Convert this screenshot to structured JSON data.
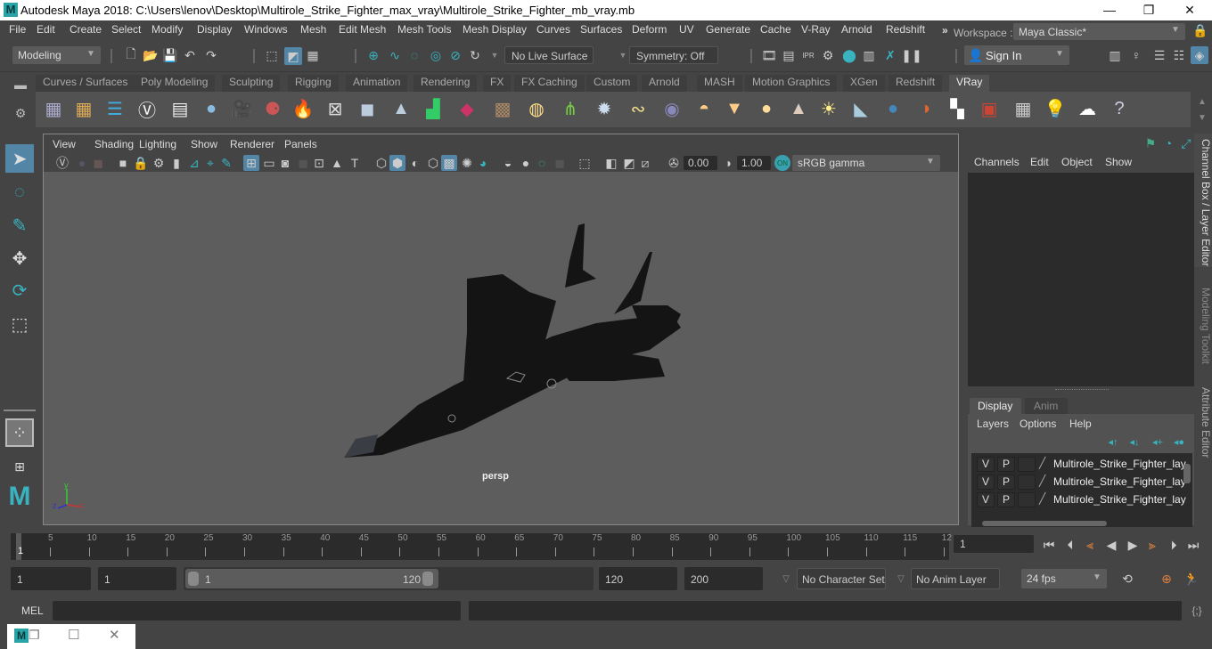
{
  "window": {
    "app_icon": "M",
    "title": "Autodesk Maya 2018: C:\\Users\\lenov\\Desktop\\Multirole_Strike_Fighter_max_vray\\Multirole_Strike_Fighter_mb_vray.mb",
    "minimize": "—",
    "maximize": "❐",
    "close": "✕"
  },
  "menubar": {
    "items": [
      "File",
      "Edit",
      "Create",
      "Select",
      "Modify",
      "Display",
      "Windows",
      "Mesh",
      "Edit Mesh",
      "Mesh Tools",
      "Mesh Display",
      "Curves",
      "Surfaces",
      "Deform",
      "UV",
      "Generate",
      "Cache",
      "V-Ray",
      "Arnold",
      "Redshift"
    ],
    "overflow": "»",
    "workspace_label": "Workspace :",
    "workspace_value": "Maya Classic*"
  },
  "statusline": {
    "menuset": "Modeling",
    "live_surface": "No Live Surface",
    "symmetry": "Symmetry: Off",
    "sign_in": "Sign In"
  },
  "shelf": {
    "tabs": [
      "Curves / Surfaces",
      "Poly Modeling",
      "Sculpting",
      "Rigging",
      "Animation",
      "Rendering",
      "FX",
      "FX Caching",
      "Custom",
      "Arnold",
      "MASH",
      "Motion Graphics",
      "XGen",
      "Redshift",
      "VRay"
    ],
    "active_tab": "VRay",
    "icons": [
      "vray-save-icon",
      "vray-load-icon",
      "vray-settings-list-icon",
      "vray-logo-icon",
      "vray-frame-buffer-icon",
      "vray-material-icon",
      "vray-camera-icon",
      "vray-multi-material-icon",
      "vray-fire-icon",
      "vray-proxy-icon",
      "vray-box-icon",
      "vray-primitive-icon",
      "vray-light-icon",
      "vray-mesh-icon",
      "vray-texture-icon",
      "vray-sphere-icon",
      "vray-fur-icon",
      "vray-displacement-icon",
      "vray-curve-icon",
      "vray-dome-icon",
      "vray-rect-light-icon",
      "vray-mesh-light-icon",
      "vray-sphere-light-icon",
      "vray-ies-light-icon",
      "vray-sun-icon",
      "vray-plane-icon",
      "vray-blue-sphere-icon",
      "vray-color-sphere-icon",
      "vray-checker-icon",
      "vray-render-icon",
      "vray-options-icon",
      "vray-light-lister-icon",
      "vray-cloud-icon",
      "help-icon"
    ]
  },
  "viewport": {
    "menus": [
      "View",
      "Shading",
      "Lighting",
      "Show",
      "Renderer",
      "Panels"
    ],
    "exposure": "0.00",
    "gamma": "1.00",
    "color_space": "sRGB gamma",
    "camera_label": "persp",
    "axis": {
      "x": "x",
      "y": "y",
      "z": "z"
    }
  },
  "channelbox": {
    "menus": [
      "Channels",
      "Edit",
      "Object",
      "Show"
    ],
    "layer_tabs": [
      "Display",
      "Anim"
    ],
    "active_layer_tab": "Display",
    "layer_menus": [
      "Layers",
      "Options",
      "Help"
    ],
    "layers": [
      {
        "v": "V",
        "p": "P",
        "name": "Multirole_Strike_Fighter_lay"
      },
      {
        "v": "V",
        "p": "P",
        "name": "Multirole_Strike_Fighter_lay"
      },
      {
        "v": "V",
        "p": "P",
        "name": "Multirole_Strike_Fighter_lay"
      }
    ]
  },
  "sidetabs": [
    "Channel Box / Layer Editor",
    "Modeling Toolkit",
    "Attribute Editor"
  ],
  "timeline": {
    "ticks": [
      "5",
      "10",
      "15",
      "20",
      "25",
      "30",
      "35",
      "40",
      "45",
      "50",
      "55",
      "60",
      "65",
      "70",
      "75",
      "80",
      "85",
      "90",
      "95",
      "100",
      "105",
      "110",
      "115",
      "12"
    ],
    "current_frame_marker": "1",
    "current_frame": "1"
  },
  "range": {
    "start": "1",
    "playback_start": "1",
    "slider_start": "1",
    "slider_end": "120",
    "playback_end": "120",
    "end": "200",
    "character_set": "No Character Set",
    "anim_layer": "No Anim Layer",
    "fps": "24 fps"
  },
  "cmdline": {
    "label": "MEL"
  }
}
